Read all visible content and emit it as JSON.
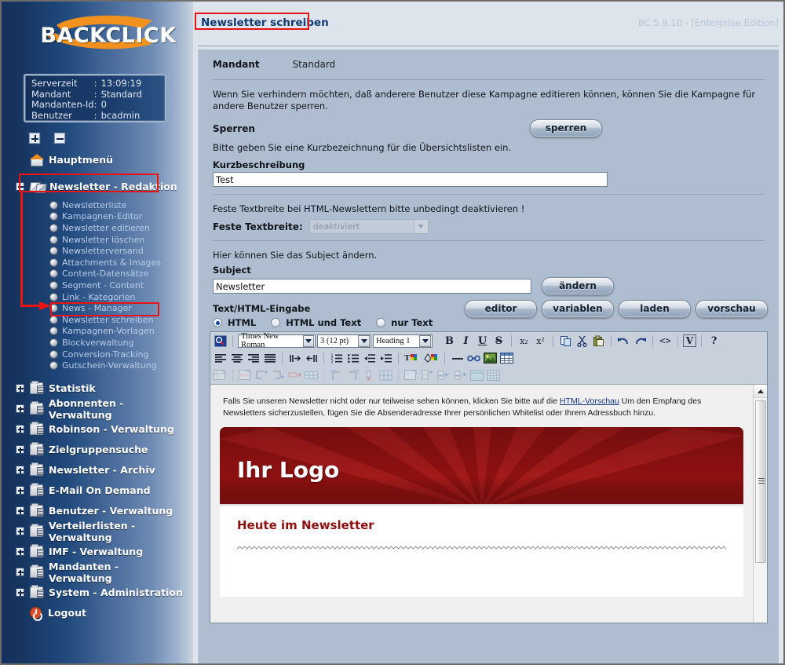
{
  "app": {
    "logo_text": "BACKCLICK",
    "version": "BC 5.9.10 - [Enterprise Edition]"
  },
  "sidebar": {
    "info": [
      {
        "key": "Serverzeit",
        "sep": ":",
        "value": "13:09:19"
      },
      {
        "key": "Mandant",
        "sep": ":",
        "value": "Standard"
      },
      {
        "key": "Mandanten-Id",
        "sep": ":",
        "value": "0"
      },
      {
        "key": "Benutzer",
        "sep": ":",
        "value": "bcadmin"
      }
    ],
    "expand_all_label": "+",
    "collapse_all_label": "-",
    "home": "Hauptmenü",
    "open_group": "Newsletter - Redaktion",
    "sub_items": [
      "Newsletterliste",
      "Kampagnen-Editor",
      "Newsletter editieren",
      "Newsletter löschen",
      "Newsletterversand",
      "Attachments & Images",
      "Content-Datensätze",
      "Segment - Content",
      "Link - Kategorien",
      "News - Manager",
      "Newsletter schreiben",
      "Kampagnen-Vorlagen",
      "Blockverwaltung",
      "Conversion-Tracking",
      "Gutschein-Verwaltung"
    ],
    "selected_sub_item": "Newsletter schreiben",
    "groups": [
      "Statistik",
      "Abonnenten - Verwaltung",
      "Robinson - Verwaltung",
      "Zielgruppensuche",
      "Newsletter - Archiv",
      "E-Mail On Demand",
      "Benutzer - Verwaltung",
      "Verteilerlisten - Verwaltung",
      "IMF - Verwaltung",
      "Mandanten - Verwaltung",
      "System - Administration"
    ],
    "logout": "Logout"
  },
  "page": {
    "title": "Newsletter schreiben",
    "mandant_label": "Mandant",
    "mandant_value": "Standard",
    "lock_text": "Wenn Sie verhindern möchten, daß anderere Benutzer diese Kampagne editieren können, können Sie die Kampagne für andere Benutzer sperren.",
    "lock_label": "Sperren",
    "lock_button": "sperren",
    "shortdesc_hint": "Bitte geben Sie eine Kurzbezeichnung für die Übersichtslisten ein.",
    "shortdesc_label": "Kurzbeschreibung",
    "shortdesc_value": "Test",
    "textwidth_hint": "Feste Textbreite bei HTML-Newslettern bitte unbedingt deaktivieren !",
    "textwidth_label": "Feste Textbreite:",
    "textwidth_value": "deaktiviert",
    "subject_hint": "Hier können Sie das Subject ändern.",
    "subject_label": "Subject",
    "subject_value": "Newsletter",
    "subject_button": "ändern",
    "input_label": "Text/HTML-Eingabe",
    "radios": [
      {
        "label": "HTML",
        "checked": true
      },
      {
        "label": "HTML und Text",
        "checked": false
      },
      {
        "label": "nur Text",
        "checked": false
      }
    ],
    "action_buttons": [
      "editor",
      "variablen",
      "laden",
      "vorschau"
    ]
  },
  "editor": {
    "font_family": "Times New Roman",
    "font_size": "3 (12 pt)",
    "block_style": "Heading 1",
    "row1_icons": [
      "source-preview-icon",
      "bold-icon",
      "italic-icon",
      "underline-icon",
      "strikethrough-icon",
      "subscript-icon",
      "superscript-icon",
      "copy-icon",
      "cut-icon",
      "paste-icon",
      "undo-icon",
      "redo-icon",
      "code-icon",
      "variable-icon",
      "help-icon"
    ],
    "row1_glyphs": [
      "B",
      "I",
      "U",
      "S",
      "x₂",
      "x²"
    ],
    "row2_icons": [
      "align-left-icon",
      "align-center-icon",
      "align-right-icon",
      "align-justify-icon",
      "ltr-icon",
      "rtl-icon",
      "ordered-list-icon",
      "unordered-list-icon",
      "outdent-icon",
      "indent-icon",
      "text-color-icon",
      "background-color-icon",
      "horizontal-rule-icon",
      "link-icon",
      "image-icon",
      "table-icon"
    ],
    "row3_icons": [
      "table-properties-icon",
      "row-properties-icon",
      "insert-row-before-icon",
      "insert-row-after-icon",
      "delete-row-icon",
      "merge-cells-icon",
      "insert-col-before-icon",
      "insert-col-after-icon",
      "delete-col-icon",
      "split-cell-icon",
      "cell-properties-icon",
      "cell-insert-icon",
      "cell-before-icon",
      "cell-after-icon",
      "cell-fill-icon",
      "grid-icon"
    ]
  },
  "newsletter": {
    "preheader_part1": "Falls Sie unseren Newsletter nicht oder nur teilweise sehen können, klicken Sie bitte auf die ",
    "preheader_link": "HTML-Vorschau",
    "preheader_part2": " Um den Empfang des Newsletters sicherzustellen, fügen Sie die Absenderadresse Ihrer persönlichen Whitelist oder Ihrem Adressbuch hinzu.",
    "logo": "Ihr Logo",
    "heading": "Heute im Newsletter"
  },
  "colors": {
    "sidebar_dark": "#15305c",
    "accent_orange": "#f08a1c",
    "annotation_red": "#e81313",
    "panel": "#aebdcf",
    "banner_red": "#911414",
    "link_blue": "#16397f"
  }
}
